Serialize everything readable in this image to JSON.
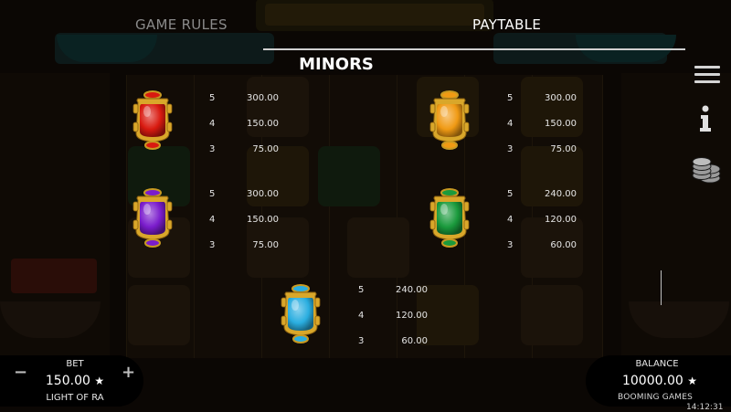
{
  "header": {
    "tabs": [
      {
        "label": "GAME RULES",
        "active": false
      },
      {
        "label": "PAYTABLE",
        "active": true
      }
    ]
  },
  "section": {
    "title": "MINORS"
  },
  "symbols": [
    {
      "name": "red-scarab",
      "color": "#d91a10",
      "pays": [
        {
          "count": "5",
          "amount": "300.00"
        },
        {
          "count": "4",
          "amount": "150.00"
        },
        {
          "count": "3",
          "amount": "75.00"
        }
      ]
    },
    {
      "name": "orange-scarab",
      "color": "#f09a14",
      "pays": [
        {
          "count": "5",
          "amount": "300.00"
        },
        {
          "count": "4",
          "amount": "150.00"
        },
        {
          "count": "3",
          "amount": "75.00"
        }
      ]
    },
    {
      "name": "purple-scarab",
      "color": "#7a1ccc",
      "pays": [
        {
          "count": "5",
          "amount": "300.00"
        },
        {
          "count": "4",
          "amount": "150.00"
        },
        {
          "count": "3",
          "amount": "75.00"
        }
      ]
    },
    {
      "name": "green-scarab",
      "color": "#1a9a3c",
      "pays": [
        {
          "count": "5",
          "amount": "240.00"
        },
        {
          "count": "4",
          "amount": "120.00"
        },
        {
          "count": "3",
          "amount": "60.00"
        }
      ]
    },
    {
      "name": "blue-scarab",
      "color": "#2aaee0",
      "pays": [
        {
          "count": "5",
          "amount": "240.00"
        },
        {
          "count": "4",
          "amount": "120.00"
        },
        {
          "count": "3",
          "amount": "60.00"
        }
      ]
    }
  ],
  "side_menu": {
    "icons": [
      "menu-icon",
      "info-icon",
      "coins-icon"
    ]
  },
  "bet": {
    "label": "BET",
    "value": "150.00",
    "star": "★",
    "minus": "−",
    "plus": "+",
    "game_name": "LIGHT OF RA"
  },
  "balance": {
    "label": "BALANCE",
    "value": "10000.00",
    "star": "★",
    "brand": "BOOMING GAMES"
  },
  "clock": "14:12:31"
}
